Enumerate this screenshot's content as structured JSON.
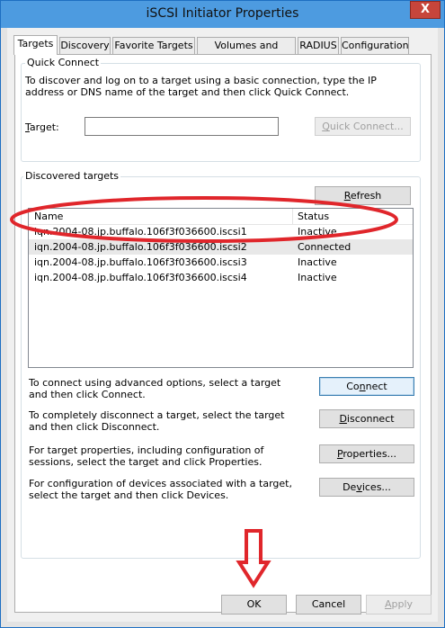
{
  "window": {
    "title": "iSCSI Initiator Properties",
    "close_glyph": "X"
  },
  "tabs": [
    {
      "label": "Targets",
      "active": true
    },
    {
      "label": "Discovery"
    },
    {
      "label": "Favorite Targets"
    },
    {
      "label": "Volumes and Devices"
    },
    {
      "label": "RADIUS"
    },
    {
      "label": "Configuration"
    }
  ],
  "quick_connect": {
    "legend": "Quick Connect",
    "description": "To discover and log on to a target using a basic connection, type the IP address or DNS name of the target and then click Quick Connect.",
    "target_label_mnemonic": "T",
    "target_label_rest": "arget:",
    "target_value": "",
    "button_mnemonic": "Q",
    "button_rest": "uick Connect..."
  },
  "discovered": {
    "legend": "Discovered targets",
    "refresh_mnemonic": "R",
    "refresh_rest": "efresh",
    "columns": [
      "Name",
      "Status"
    ],
    "rows": [
      {
        "name": "iqn.2004-08.jp.buffalo.106f3f036600.iscsi1",
        "status": "Inactive"
      },
      {
        "name": "iqn.2004-08.jp.buffalo.106f3f036600.iscsi2",
        "status": "Connected"
      },
      {
        "name": "iqn.2004-08.jp.buffalo.106f3f036600.iscsi3",
        "status": "Inactive"
      },
      {
        "name": "iqn.2004-08.jp.buffalo.106f3f036600.iscsi4",
        "status": "Inactive"
      }
    ]
  },
  "actions": [
    {
      "text": "To connect using advanced options, select a target and then click Connect.",
      "mnemonic": "",
      "button_pre": "Co",
      "button_mnemonic": "n",
      "button_rest": "nect"
    },
    {
      "text": "To completely disconnect a target, select the target and then click Disconnect.",
      "button_pre": "",
      "button_mnemonic": "D",
      "button_rest": "isconnect"
    },
    {
      "text": "For target properties, including configuration of sessions, select the target and click Properties.",
      "button_pre": "",
      "button_mnemonic": "P",
      "button_rest": "roperties..."
    },
    {
      "text": "For configuration of devices associated with a target, select the target and then click Devices.",
      "button_pre": "De",
      "button_mnemonic": "v",
      "button_rest": "ices..."
    }
  ],
  "footer": {
    "ok": "OK",
    "cancel": "Cancel",
    "apply_mnemonic": "A",
    "apply_rest": "pply"
  },
  "annotation_color": "#e0262b"
}
